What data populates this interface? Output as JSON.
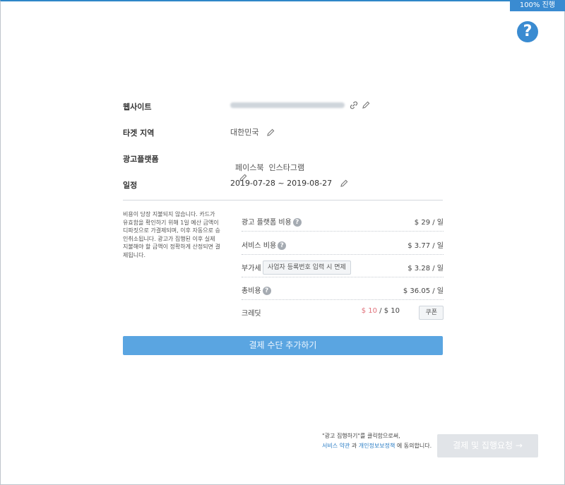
{
  "progress_badge": "100% 진행",
  "help_icon": "?",
  "fields": {
    "website": {
      "label": "웹사이트"
    },
    "target_region": {
      "label": "타겟 지역",
      "value": "대한민국"
    },
    "ad_platform": {
      "label": "광고플랫폼",
      "value": "페이스북  인스타그램"
    },
    "schedule": {
      "label": "일정",
      "value": "2019-07-28 ~ 2019-08-27"
    }
  },
  "note": "비용이 당장 지불되지 않습니다. 카드가 유효함을 확인하기 위해 1일 예산 금액이 디파짓으로 가결제되며, 이후 자동으로 승인취소됩니다. 광고가 집행된 이후 실제 지불해야 할 금액이 정확하게 산정되면 결제됩니다.",
  "costs": [
    {
      "label": "광고 플랫폼 비용",
      "value": "$ 29 / 일"
    },
    {
      "label": "서비스 비용",
      "value": "$ 3.77 / 일"
    },
    {
      "label": "부가세",
      "value": "$ 3.28 / 일",
      "button": "사업자 등록번호 입력 시 면제"
    },
    {
      "label": "총비용",
      "value": "$ 36.05 / 일"
    },
    {
      "label": "크레딧",
      "value_highlight": "$ 10",
      "value_rest": " / $ 10",
      "button": "쿠폰"
    }
  ],
  "colors": {
    "accent": "#3a8bd1",
    "primary_button": "#5aa5e1",
    "credit_highlight": "#e0717a"
  },
  "primary_button": "결제 수단 추가하기",
  "consent": {
    "line1": "\"광고 집행하기\"를 클릭함으로써,",
    "terms": "서비스 약관",
    "and": " 과 ",
    "privacy": "개인정보보정책",
    "tail": " 에 동의합니다."
  },
  "submit_button": "결제 및 집행요청 →"
}
